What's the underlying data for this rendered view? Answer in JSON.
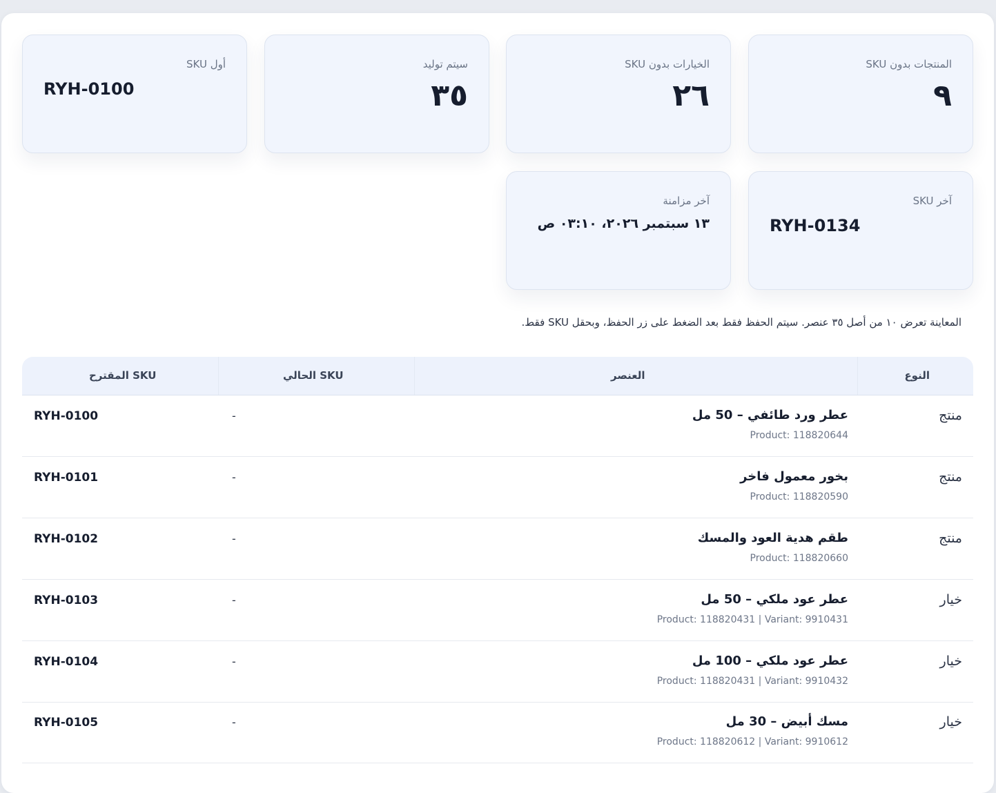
{
  "stats": {
    "products_without_sku": {
      "label": "المنتجات بدون SKU",
      "value": "٩"
    },
    "variants_without_sku": {
      "label": "الخيارات بدون SKU",
      "value": "٢٦"
    },
    "to_generate": {
      "label": "سيتم توليد",
      "value": "٣٥"
    },
    "first_sku": {
      "label": "أول SKU",
      "value": "RYH-0100"
    },
    "last_sku": {
      "label": "آخر SKU",
      "value": "RYH-0134"
    },
    "last_sync": {
      "label": "آخر مزامنة",
      "value": "١٣ سبتمبر ٢٠٢٦، ٠٣:١٠ ص"
    }
  },
  "preview_note": "المعاينة تعرض ١٠ من أصل ٣٥ عنصر. سيتم الحفظ فقط بعد الضغط على زر الحفظ، وبحقل SKU فقط.",
  "table": {
    "headers": {
      "type": "النوع",
      "item": "العنصر",
      "current_sku": "SKU الحالي",
      "suggested_sku": "SKU المقترح"
    },
    "rows": [
      {
        "type": "منتج",
        "name": "عطر ورد طائفي – 50 مل",
        "meta": "Product: 118820644",
        "current": "-",
        "sku": "RYH-0100"
      },
      {
        "type": "منتج",
        "name": "بخور معمول فاخر",
        "meta": "Product: 118820590",
        "current": "-",
        "sku": "RYH-0101"
      },
      {
        "type": "منتج",
        "name": "طقم هدية العود والمسك",
        "meta": "Product: 118820660",
        "current": "-",
        "sku": "RYH-0102"
      },
      {
        "type": "خيار",
        "name": "عطر عود ملكي – 50 مل",
        "meta": "Product: 118820431 | Variant: 9910431",
        "current": "-",
        "sku": "RYH-0103"
      },
      {
        "type": "خيار",
        "name": "عطر عود ملكي – 100 مل",
        "meta": "Product: 118820431 | Variant: 9910432",
        "current": "-",
        "sku": "RYH-0104"
      },
      {
        "type": "خيار",
        "name": "مسك أبيض – 30 مل",
        "meta": "Product: 118820612 | Variant: 9910612",
        "current": "-",
        "sku": "RYH-0105"
      }
    ]
  }
}
